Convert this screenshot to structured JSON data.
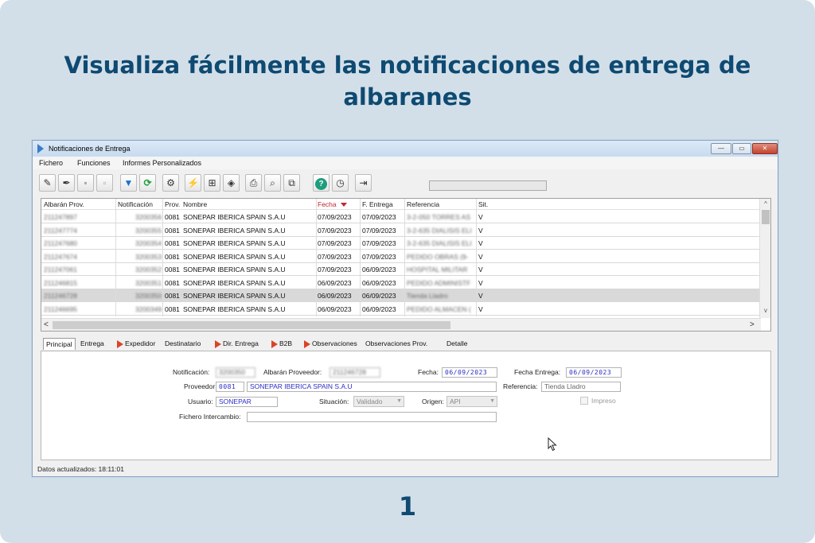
{
  "headline": "Visualiza fácilmente las notificaciones de entrega de albaranes",
  "step_number": "1",
  "window": {
    "title": "Notificaciones de Entrega",
    "controls": {
      "minimize": "—",
      "maximize": "▭",
      "close": "✕"
    }
  },
  "menu": [
    "Fichero",
    "Funciones",
    "Informes Personalizados"
  ],
  "toolbar": [
    {
      "icon": "edit-icon",
      "glyph": "✎"
    },
    {
      "icon": "save-pen-icon",
      "glyph": "✒"
    },
    {
      "icon": "disk-icon",
      "glyph": "▪"
    },
    {
      "icon": "close-doc-icon",
      "glyph": "▫"
    },
    {
      "icon": "filter-icon",
      "glyph": "▼"
    },
    {
      "icon": "refresh-icon",
      "glyph": "⟳"
    },
    {
      "icon": "gear-icon",
      "glyph": "⚙"
    },
    {
      "icon": "run-icon",
      "glyph": "⚡"
    },
    {
      "icon": "cart-icon",
      "glyph": "⊞"
    },
    {
      "icon": "eraser-icon",
      "glyph": "◈"
    },
    {
      "icon": "print-icon",
      "glyph": "⎙"
    },
    {
      "icon": "search-icon",
      "glyph": "⌕"
    },
    {
      "icon": "export-icon",
      "glyph": "⧉"
    },
    {
      "icon": "help-icon",
      "glyph": "?"
    },
    {
      "icon": "clock-icon",
      "glyph": "◷"
    },
    {
      "icon": "exit-icon",
      "glyph": "⇥"
    }
  ],
  "grid": {
    "columns": [
      "Albarán Prov.",
      "Notificación",
      "Prov.",
      "Nombre",
      "Fecha",
      "F. Entrega",
      "Referencia",
      "Sit."
    ],
    "sorted_column": "Fecha",
    "rows": [
      {
        "albaran": "211247897",
        "notif": "3200356",
        "prov": "0081",
        "nombre": "SONEPAR IBERICA SPAIN S.A.U",
        "fecha": "07/09/2023",
        "entrega": "07/09/2023",
        "ref": "3-2-050 TORRES AS",
        "sit": "V"
      },
      {
        "albaran": "211247774",
        "notif": "3200355",
        "prov": "0081",
        "nombre": "SONEPAR IBERICA SPAIN S.A.U",
        "fecha": "07/09/2023",
        "entrega": "07/09/2023",
        "ref": "3-2-635 DIALISIS ELI",
        "sit": "V"
      },
      {
        "albaran": "211247680",
        "notif": "3200354",
        "prov": "0081",
        "nombre": "SONEPAR IBERICA SPAIN S.A.U",
        "fecha": "07/09/2023",
        "entrega": "07/09/2023",
        "ref": "3-2-635 DIALISIS ELI",
        "sit": "V"
      },
      {
        "albaran": "211247674",
        "notif": "3200353",
        "prov": "0081",
        "nombre": "SONEPAR IBERICA SPAIN S.A.U",
        "fecha": "07/09/2023",
        "entrega": "07/09/2023",
        "ref": "PEDIDO OBRAS (9-",
        "sit": "V"
      },
      {
        "albaran": "211247061",
        "notif": "3200352",
        "prov": "0081",
        "nombre": "SONEPAR IBERICA SPAIN S.A.U",
        "fecha": "07/09/2023",
        "entrega": "06/09/2023",
        "ref": "HOSPITAL MILITAR",
        "sit": "V"
      },
      {
        "albaran": "211246815",
        "notif": "3200351",
        "prov": "0081",
        "nombre": "SONEPAR IBERICA SPAIN S.A.U",
        "fecha": "06/09/2023",
        "entrega": "06/09/2023",
        "ref": "PEDIDO ADMINISTF",
        "sit": "V"
      },
      {
        "albaran": "211246728",
        "notif": "3200350",
        "prov": "0081",
        "nombre": "SONEPAR IBERICA SPAIN S.A.U",
        "fecha": "06/09/2023",
        "entrega": "06/09/2023",
        "ref": "Tienda Lladro",
        "sit": "V",
        "selected": true
      },
      {
        "albaran": "211246695",
        "notif": "3200349",
        "prov": "0081",
        "nombre": "SONEPAR IBERICA SPAIN S.A.U",
        "fecha": "06/09/2023",
        "entrega": "06/09/2023",
        "ref": "PEDIDO ALMACEN (",
        "sit": "V"
      }
    ],
    "scroll": {
      "left": "<",
      "right": ">",
      "up": "^",
      "down": "v"
    }
  },
  "tabs": [
    {
      "label": "Principal",
      "flag": false,
      "active": true
    },
    {
      "label": "Entrega",
      "flag": false
    },
    {
      "label": "Expedidor",
      "flag": true
    },
    {
      "label": "Destinatario",
      "flag": false
    },
    {
      "label": "Dir. Entrega",
      "flag": true
    },
    {
      "label": "B2B",
      "flag": true
    },
    {
      "label": "Observaciones",
      "flag": true
    },
    {
      "label": "Observaciones Prov.",
      "flag": false
    },
    {
      "label": "Detalle",
      "flag": false
    }
  ],
  "form": {
    "notificacion_label": "Notificación:",
    "notificacion_value": "3200350",
    "albaran_label": "Albarán Proveedor:",
    "albaran_value": "211246728",
    "fecha_label": "Fecha:",
    "fecha_value": "06/09/2023",
    "fecha_entrega_label": "Fecha Entrega:",
    "fecha_entrega_value": "06/09/2023",
    "proveedor_label": "Proveedor:",
    "proveedor_code": "0081",
    "proveedor_name": "SONEPAR IBERICA SPAIN S.A.U",
    "referencia_label": "Referencia:",
    "referencia_value": "Tienda Lladro",
    "usuario_label": "Usuario:",
    "usuario_value": "SONEPAR",
    "situacion_label": "Situación:",
    "situacion_value": "Validado",
    "origen_label": "Origen:",
    "origen_value": "API",
    "impreso_label": "Impreso",
    "fichero_label": "Fichero Intercambio:",
    "fichero_value": ""
  },
  "status_bar": "Datos actualizados: 18:11:01"
}
